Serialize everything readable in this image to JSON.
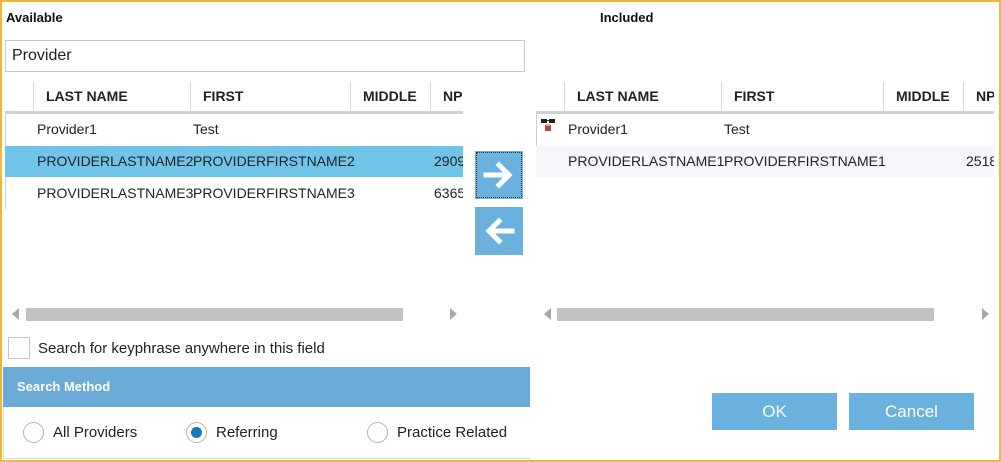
{
  "available": {
    "title": "Available",
    "search_value": "Provider",
    "columns": [
      "LAST NAME",
      "FIRST",
      "MIDDLE",
      "NP"
    ],
    "rows": [
      {
        "last": "Provider1",
        "first": "Test",
        "middle": "",
        "npi": ""
      },
      {
        "last": "PROVIDERLASTNAME2",
        "first": "PROVIDERFIRSTNAME2",
        "middle": "",
        "npi": "2909"
      },
      {
        "last": "PROVIDERLASTNAME3",
        "first": "PROVIDERFIRSTNAME3",
        "middle": "",
        "npi": "6365"
      }
    ],
    "selected_row": 1
  },
  "included": {
    "title": "Included",
    "columns": [
      "LAST NAME",
      "FIRST",
      "MIDDLE",
      "NP"
    ],
    "rows": [
      {
        "last": "Provider1",
        "first": "Test",
        "middle": "",
        "npi": "",
        "icon": "provider-person-icon"
      },
      {
        "last": "PROVIDERLASTNAME1",
        "first": "PROVIDERFIRSTNAME1",
        "middle": "",
        "npi": "2518"
      }
    ]
  },
  "move_buttons": {
    "add_icon": "arrow-right-icon",
    "remove_icon": "arrow-left-icon"
  },
  "search_anywhere": {
    "label": "Search for keyphrase anywhere in this field",
    "checked": false
  },
  "search_method": {
    "title": "Search Method",
    "options": [
      "All Providers",
      "Referring",
      "Practice Related"
    ],
    "selected": "Referring"
  },
  "actions": {
    "ok_label": "OK",
    "cancel_label": "Cancel"
  },
  "colors": {
    "accent": "#6ab1de",
    "selected_row": "#70c4e8",
    "frame_border": "#f0b73e",
    "radio_selected": "#1a77b8"
  }
}
